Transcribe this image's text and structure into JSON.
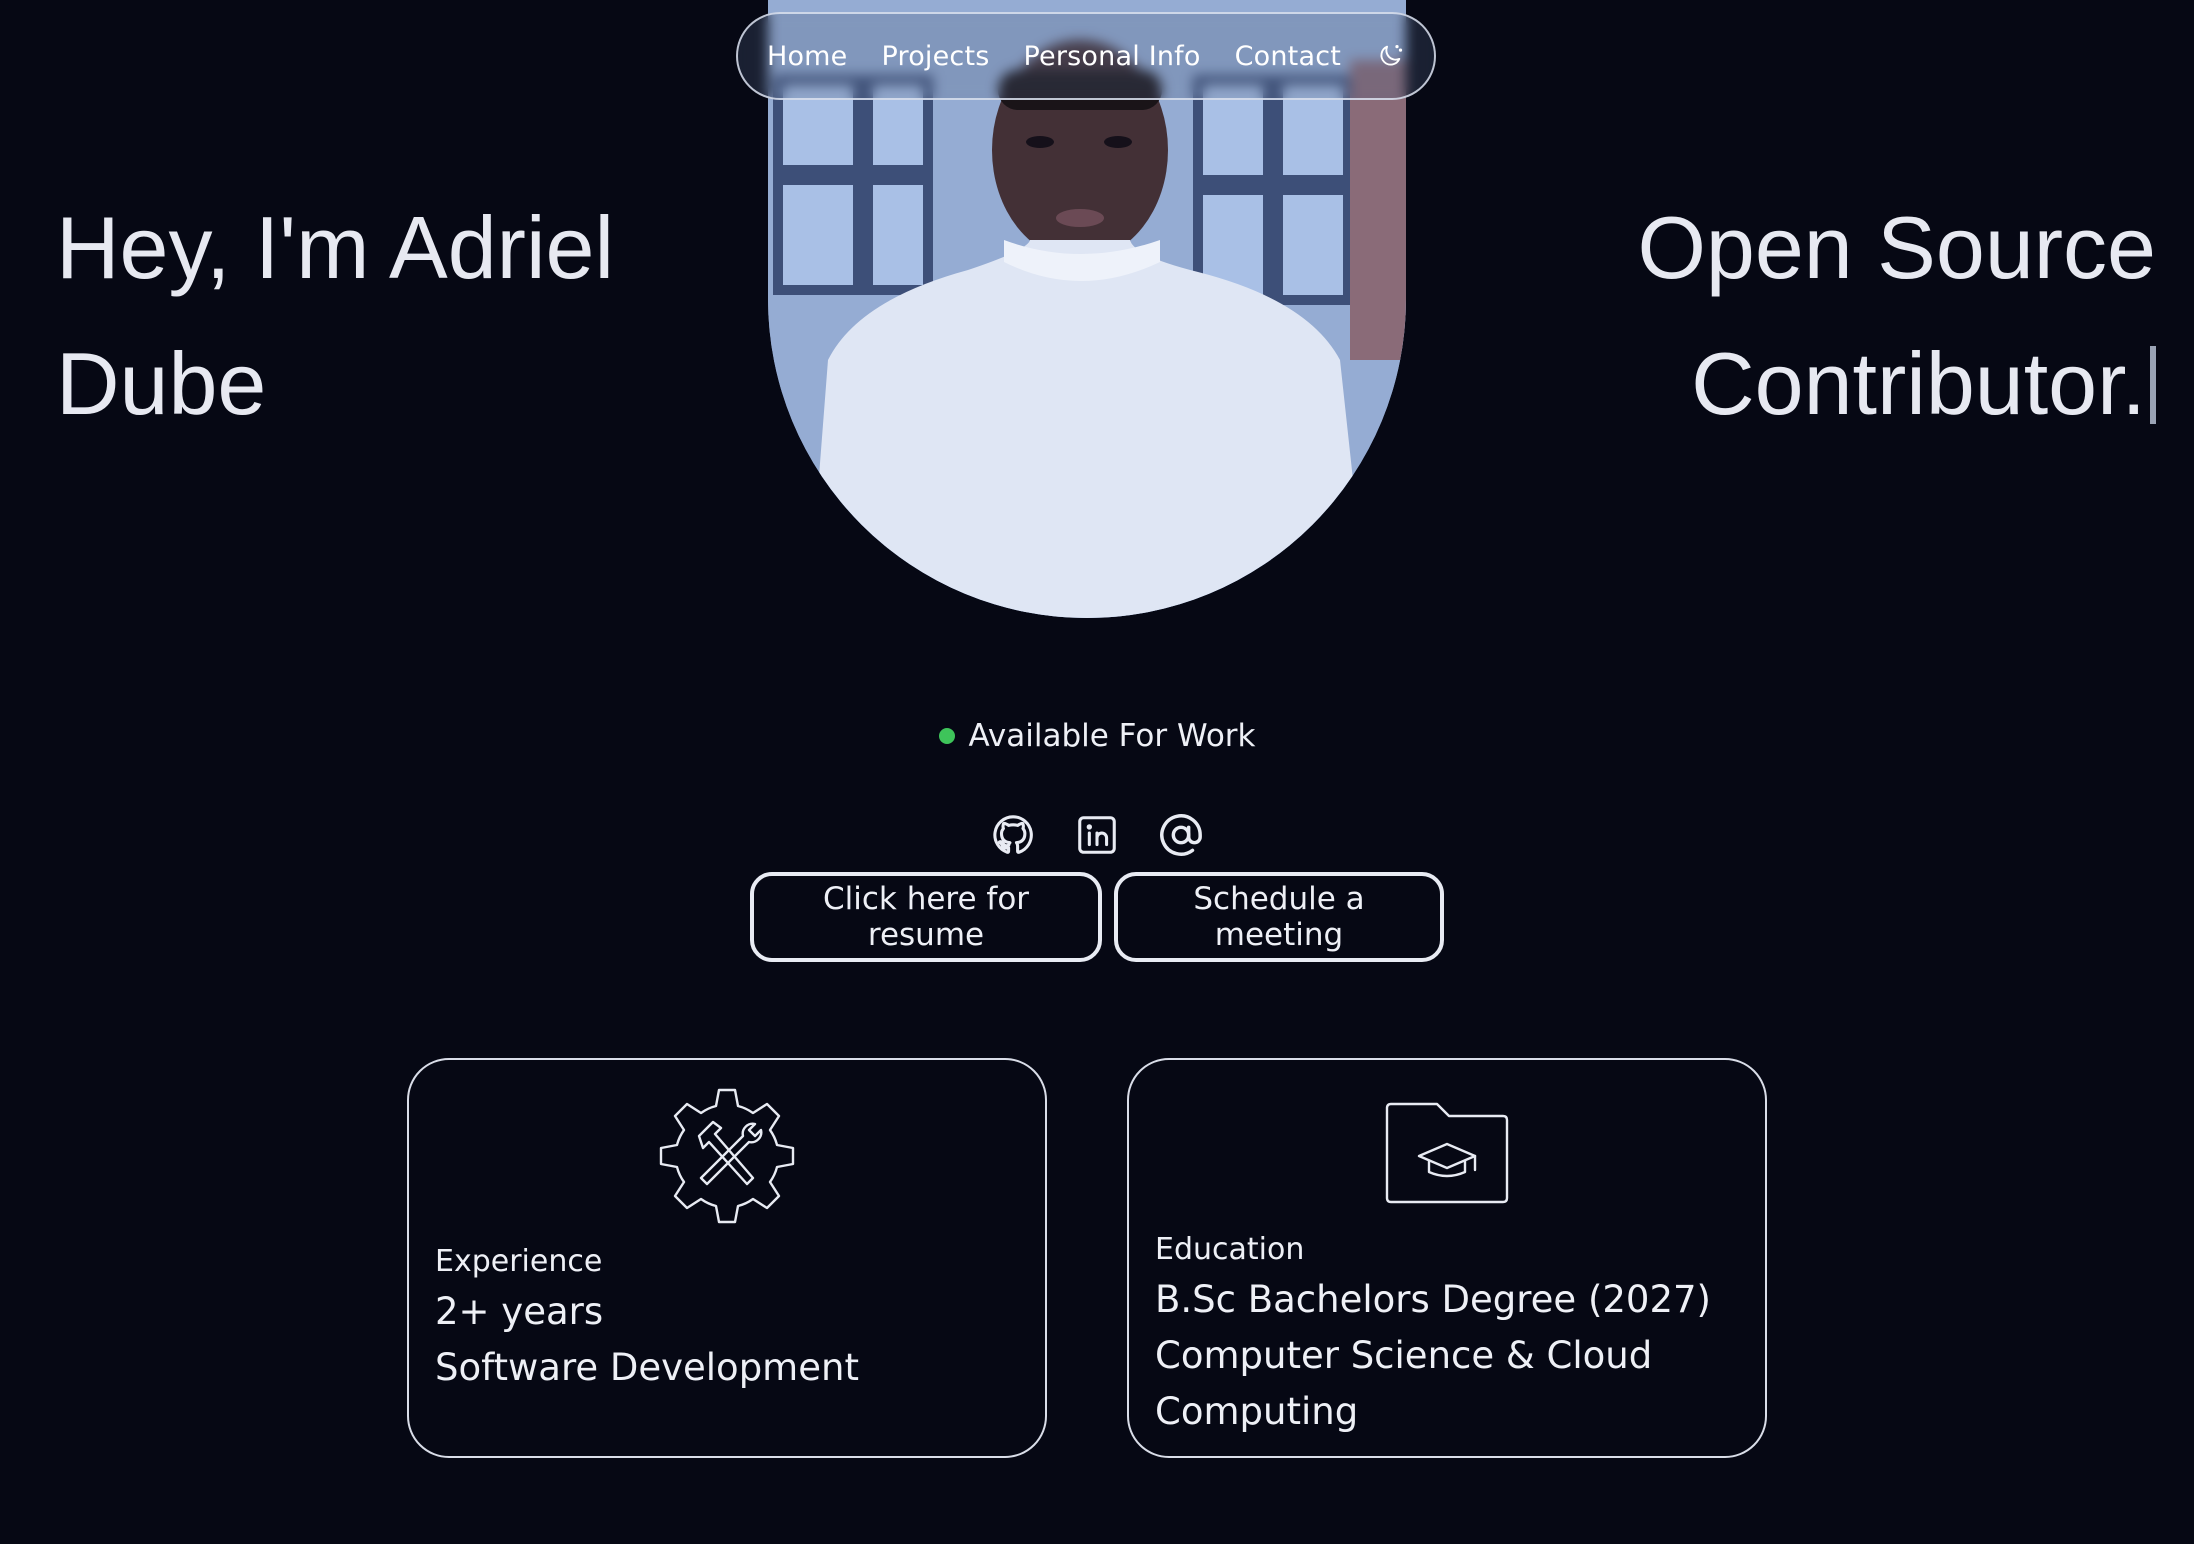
{
  "nav": {
    "items": [
      "Home",
      "Projects",
      "Personal Info",
      "Contact"
    ],
    "theme_toggle_icon": "moon-icon"
  },
  "hero": {
    "greeting_line1": "Hey, I'm Adriel",
    "greeting_line2": "Dube",
    "role_line1": "Open Source",
    "role_line2": "Contributor."
  },
  "portrait": {
    "icon": "profile-photo"
  },
  "status": {
    "text": "Available For Work",
    "color": "#3ec45a"
  },
  "socials": {
    "icons": [
      "github-icon",
      "linkedin-icon",
      "email-at-icon"
    ]
  },
  "buttons": {
    "resume": "Click here for resume",
    "meeting": "Schedule a meeting"
  },
  "cards": {
    "experience": {
      "icon": "tools-gear-icon",
      "label": "Experience",
      "line1": "2+ years",
      "line2": "Software Development"
    },
    "education": {
      "icon": "graduation-folder-icon",
      "label": "Education",
      "line1": "B.Sc Bachelors Degree (2027)",
      "line2": "Computer Science & Cloud",
      "line3": "Computing"
    }
  },
  "colors": {
    "background": "#060814",
    "text": "#e6e9f2",
    "accent_status": "#3ec45a"
  }
}
